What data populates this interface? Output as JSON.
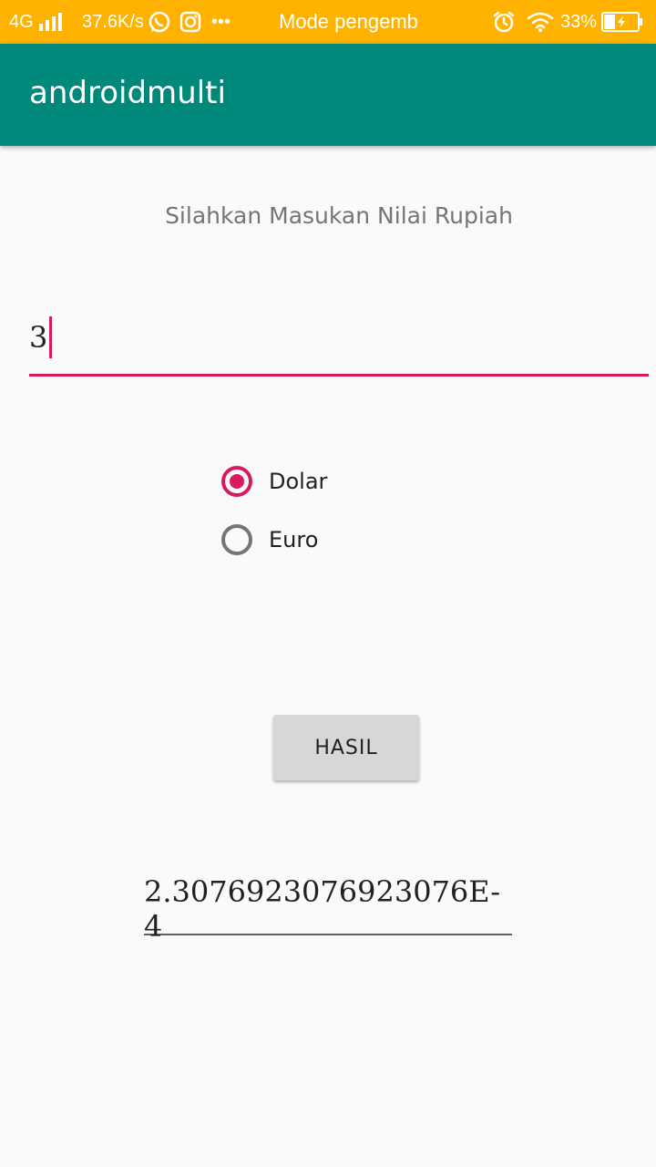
{
  "status_bar": {
    "network": "4G",
    "speed": "37.6K/s",
    "more": "•••",
    "notification": "Mode pengemb",
    "battery": "33%"
  },
  "app_bar": {
    "title": "androidmulti"
  },
  "main": {
    "prompt": "Silahkan Masukan Nilai Rupiah",
    "input_value": "3",
    "options": [
      {
        "label": "Dolar",
        "checked": true
      },
      {
        "label": "Euro",
        "checked": false
      }
    ],
    "button_label": "HASIL",
    "result": "2.3076923076923076E-4"
  },
  "colors": {
    "status_bar": "#ffb300",
    "app_bar": "#00897b",
    "accent": "#d81b60"
  }
}
